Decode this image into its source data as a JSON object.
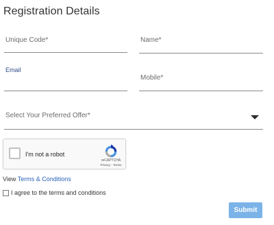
{
  "form": {
    "title": "Registration Details",
    "unique_code_label": "Unique Code*",
    "name_label": "Name*",
    "email_label": "Email",
    "mobile_label": "Mobile*",
    "offer_placeholder": "Select Your Preferred Offer*"
  },
  "captcha": {
    "label": "I'm not a robot",
    "brand": "reCAPTCHA",
    "links": "Privacy - Terms",
    "icon": "recaptcha-logo"
  },
  "terms": {
    "prefix": "View",
    "link": "Terms & Conditions",
    "agree_label": "I agree to the terms and conditions"
  },
  "actions": {
    "submit_label": "Submit"
  },
  "colors": {
    "link": "#2a62b8",
    "submit_bg": "#7bb3e8",
    "email_label": "#2f4b8a"
  }
}
